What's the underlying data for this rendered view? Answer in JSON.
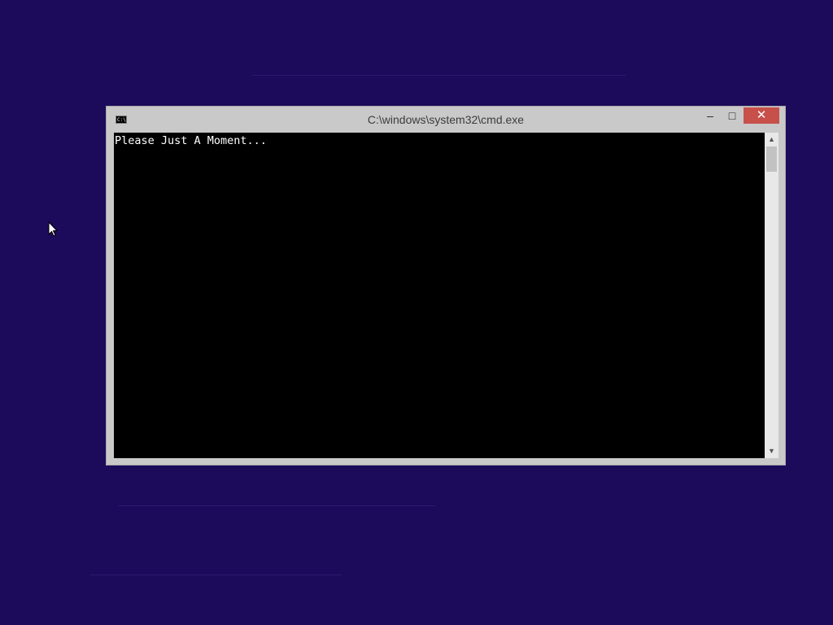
{
  "window": {
    "title": "C:\\windows\\system32\\cmd.exe",
    "icon": "cmd-icon",
    "icon_text": "C:\\",
    "minimize_glyph": "–",
    "maximize_glyph": "□",
    "close_glyph": "✕"
  },
  "console": {
    "lines": [
      "Please Just A Moment..."
    ],
    "background": "#000000",
    "text_color": "#ffffff"
  },
  "scrollbar": {
    "up_glyph": "▲",
    "down_glyph": "▼"
  },
  "colors": {
    "desktop": "#1c0a5a",
    "close_button": "#c7504b"
  }
}
